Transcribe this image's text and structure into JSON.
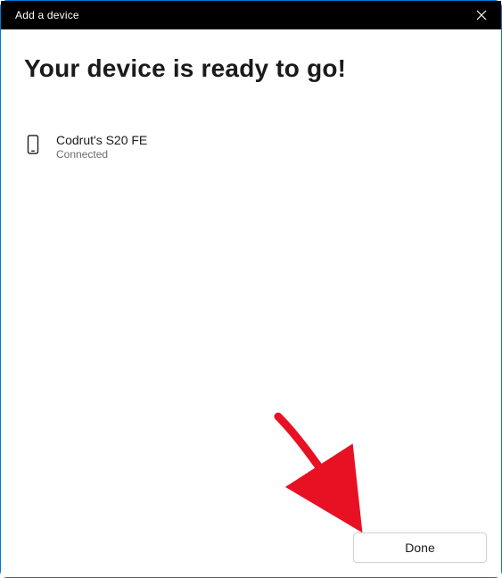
{
  "titlebar": {
    "title": "Add a device"
  },
  "main": {
    "heading": "Your device is ready to go!",
    "device": {
      "name": "Codrut's S20 FE",
      "status": "Connected"
    }
  },
  "footer": {
    "done_label": "Done"
  }
}
